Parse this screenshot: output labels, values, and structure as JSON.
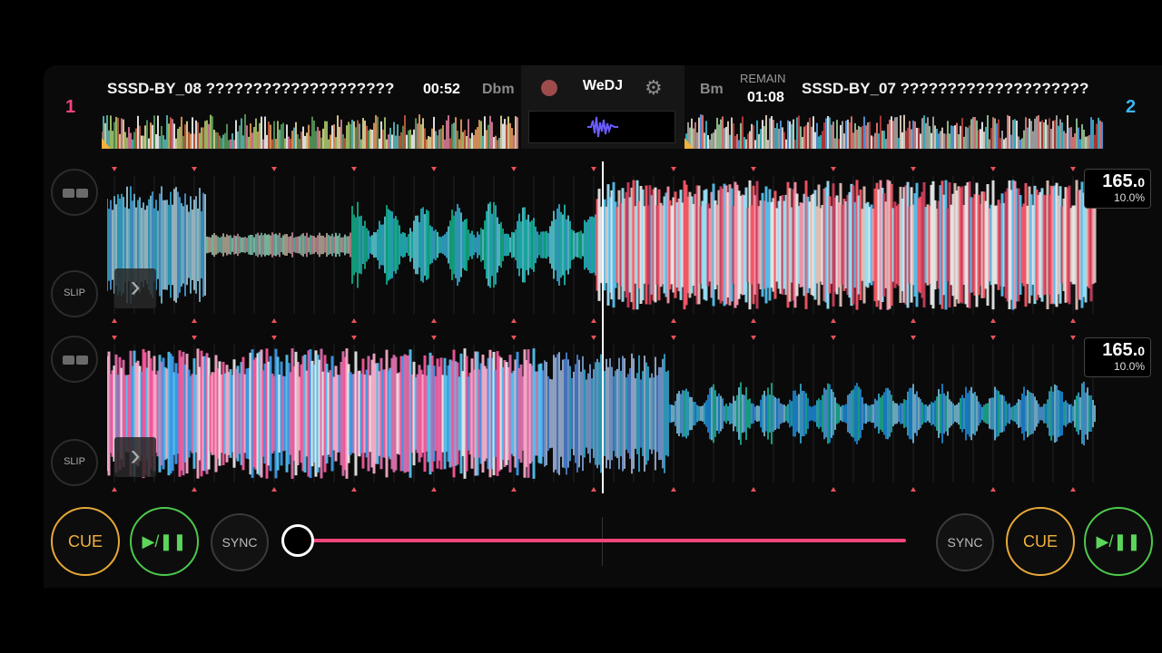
{
  "deck1": {
    "number": "1",
    "title": "SSSD-BY_08 ????????????????????",
    "time": "00:52",
    "key": "Dbm",
    "bpm_int": "165.",
    "bpm_dec": "0",
    "pitch": "10.0%",
    "slip_label": "SLIP"
  },
  "deck2": {
    "number": "2",
    "title": "SSSD-BY_07 ????????????????????",
    "remain_label": "REMAIN",
    "time": "01:08",
    "key": "Bm",
    "bpm_int": "165.",
    "bpm_dec": "0",
    "pitch": "10.0%",
    "slip_label": "SLIP"
  },
  "center": {
    "app_name": "WeDJ",
    "settings_icon": "gear-icon",
    "waveform_icon": "waveform-icon"
  },
  "controls": {
    "cue_label": "CUE",
    "play_label": "▶/❚❚",
    "sync_label": "SYNC",
    "crossfader_position": 0.0
  },
  "colors": {
    "deck1_number": "#f0457a",
    "deck2_number": "#3bb6f0",
    "cue": "#f2b13c",
    "play": "#5bd65b",
    "crossfader": "#f0457a"
  }
}
